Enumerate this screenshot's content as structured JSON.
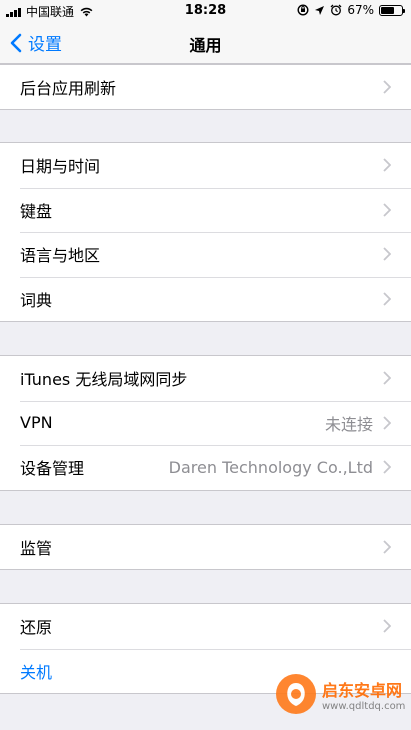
{
  "status_bar": {
    "carrier": "中国联通",
    "time": "18:28",
    "battery_percent": "67%",
    "battery_level": 0.67
  },
  "nav": {
    "back_label": "设置",
    "title": "通用"
  },
  "groups": [
    {
      "rows": [
        {
          "label": "后台应用刷新"
        }
      ]
    },
    {
      "rows": [
        {
          "label": "日期与时间"
        },
        {
          "label": "键盘"
        },
        {
          "label": "语言与地区"
        },
        {
          "label": "词典"
        }
      ]
    },
    {
      "rows": [
        {
          "label": "iTunes 无线局域网同步"
        },
        {
          "label": "VPN",
          "detail": "未连接"
        },
        {
          "label": "设备管理",
          "detail": "Daren Technology Co.,Ltd"
        }
      ]
    },
    {
      "rows": [
        {
          "label": "监管"
        }
      ]
    },
    {
      "rows": [
        {
          "label": "还原"
        },
        {
          "label": "关机"
        }
      ]
    }
  ],
  "watermark": {
    "name": "启东安卓网",
    "url": "www.qdltdq.com"
  },
  "colors": {
    "accent": "#007aff",
    "background": "#efeff4",
    "detail_text": "#8e8e93"
  }
}
